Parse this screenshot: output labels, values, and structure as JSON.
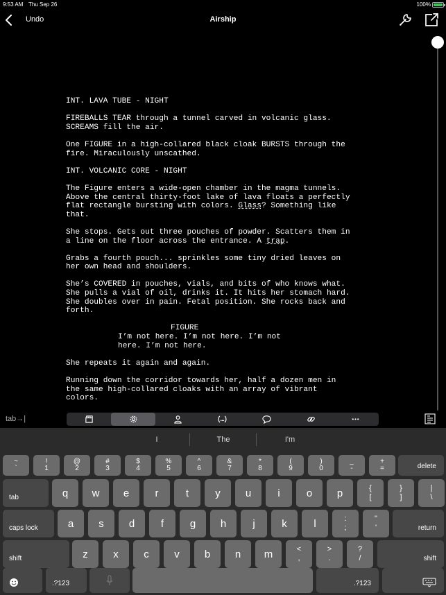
{
  "status_bar": {
    "time": "9:53 AM",
    "date": "Thu Sep 26",
    "battery_percent": "100%",
    "battery_color": "#35c759"
  },
  "nav": {
    "back_icon": "chevron-left-icon",
    "undo_label": "Undo",
    "title": "Airship",
    "wrench_icon": "wrench-icon",
    "share_icon": "share-out-icon"
  },
  "script": {
    "blocks": [
      {
        "type": "heading",
        "text": "INT. LAVA TUBE - NIGHT"
      },
      {
        "type": "action",
        "text": "FIREBALLS TEAR through a tunnel carved in volcanic glass.\nSCREAMS fill the air."
      },
      {
        "type": "action",
        "text": "One FIGURE in a high-collared black cloak BURSTS through the\nfire. Miraculously unscathed."
      },
      {
        "type": "heading",
        "text": "INT. VOLCANIC CORE - NIGHT"
      },
      {
        "type": "action",
        "text_a": "The Figure enters a wide-open chamber in the magma tunnels.\nAbove the central thirty-foot lake of lava floats a perfectly\nflat rectangle bursting with colors. ",
        "underlined": "Glass",
        "text_b": "? Something like\nthat."
      },
      {
        "type": "action",
        "text_a": "She stops. Gets out three pouches of powder. Scatters them in\na line on the floor across the entrance. A ",
        "underlined": "trap",
        "text_b": "."
      },
      {
        "type": "action",
        "text": "Grabs a fourth pouch... sprinkles some tiny dried leaves on\nher own head and shoulders."
      },
      {
        "type": "action",
        "text": "She’s COVERED in pouches, vials, and bits of who knows what.\nShe pulls a vial of oil, drinks it. It hits her stomach hard.\nShe doubles over in pain. Fetal position. She rocks back and\nforth."
      },
      {
        "type": "character",
        "text": "FIGURE"
      },
      {
        "type": "dialogue",
        "text": "I’m not here. I’m not here. I’m not\nhere. I’m not here."
      },
      {
        "type": "action",
        "text": "She repeats it again and again."
      },
      {
        "type": "action",
        "text": "Running down the corridor towards her, half a dozen men in\nthe same high-collared cloaks with an array of vibrant\ncolors."
      }
    ]
  },
  "accessory": {
    "tab_label": "tab→|",
    "tools": [
      {
        "name": "scene-icon"
      },
      {
        "name": "settings-gear-icon"
      },
      {
        "name": "character-icon"
      },
      {
        "name": "parenthetical-icon"
      },
      {
        "name": "comment-icon"
      },
      {
        "name": "link-icon"
      },
      {
        "name": "more-icon"
      }
    ],
    "doc_icon": "document-outline-icon"
  },
  "keyboard": {
    "predictions": [
      "I",
      "The",
      "I'm"
    ],
    "number_row": [
      {
        "top": "~",
        "bottom": "`"
      },
      {
        "top": "!",
        "bottom": "1"
      },
      {
        "top": "@",
        "bottom": "2"
      },
      {
        "top": "#",
        "bottom": "3"
      },
      {
        "top": "$",
        "bottom": "4"
      },
      {
        "top": "%",
        "bottom": "5"
      },
      {
        "top": "^",
        "bottom": "6"
      },
      {
        "top": "&",
        "bottom": "7"
      },
      {
        "top": "*",
        "bottom": "8"
      },
      {
        "top": "(",
        "bottom": "9"
      },
      {
        "top": ")",
        "bottom": "0"
      },
      {
        "top": "_",
        "bottom": "-"
      },
      {
        "top": "+",
        "bottom": "="
      }
    ],
    "delete_label": "delete",
    "tab_label": "tab",
    "row_q": [
      "q",
      "w",
      "e",
      "r",
      "t",
      "y",
      "u",
      "i",
      "o",
      "p"
    ],
    "row_q_extra": [
      {
        "top": "{",
        "bottom": "["
      },
      {
        "top": "}",
        "bottom": "]"
      },
      {
        "top": "|",
        "bottom": "\\"
      }
    ],
    "caps_label": "caps lock",
    "row_a": [
      "a",
      "s",
      "d",
      "f",
      "g",
      "h",
      "j",
      "k",
      "l"
    ],
    "row_a_extra": [
      {
        "top": ":",
        "bottom": ";"
      },
      {
        "top": "\"",
        "bottom": "'"
      }
    ],
    "return_label": "return",
    "shift_label": "shift",
    "row_z": [
      "z",
      "x",
      "c",
      "v",
      "b",
      "n",
      "m"
    ],
    "row_z_extra": [
      {
        "top": "<",
        "bottom": ","
      },
      {
        "top": ">",
        "bottom": "."
      },
      {
        "top": "?",
        "bottom": "/"
      }
    ],
    "emoji_icon": "emoji-icon",
    "numbers_label": ".?123",
    "mic_icon": "microphone-icon",
    "keyboard_dismiss_icon": "keyboard-dismiss-icon"
  }
}
